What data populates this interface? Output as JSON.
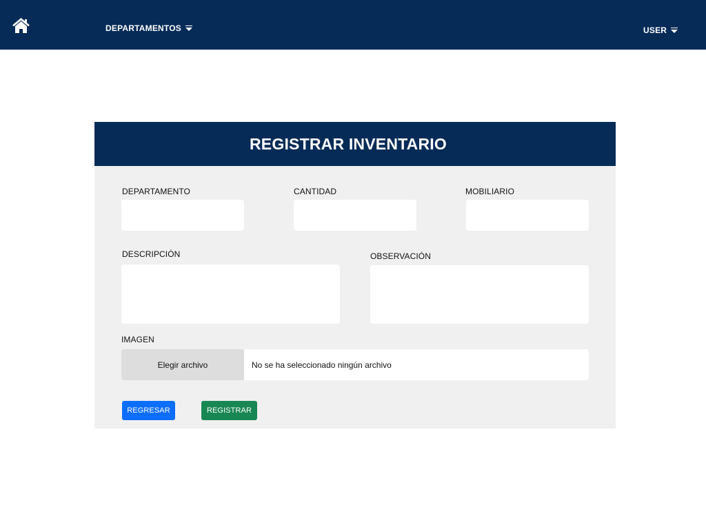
{
  "nav": {
    "home_icon": "home-icon",
    "departments_label": "DEPARTAMENTOS",
    "user_label": "USER"
  },
  "form": {
    "title": "REGISTRAR INVENTARIO",
    "fields": {
      "departamento": {
        "label": "DEPARTAMENTO",
        "value": ""
      },
      "cantidad": {
        "label": "CANTIDAD",
        "value": ""
      },
      "mobiliario": {
        "label": "MOBILIARIO",
        "value": ""
      },
      "descripcion": {
        "label": "DESCRIPCIÓN",
        "value": ""
      },
      "observacion": {
        "label": "OBSERVACIÓN",
        "value": ""
      },
      "imagen": {
        "label": "IMAGEN",
        "button_label": "Elegir archivo",
        "status": "No se ha seleccionado ningún archivo"
      }
    },
    "buttons": {
      "back": "REGRESAR",
      "register": "REGISTRAR"
    }
  },
  "colors": {
    "navy": "#062b57",
    "panel": "#f0f0f0",
    "primary_button": "#0d6efd",
    "success_button": "#198754"
  }
}
